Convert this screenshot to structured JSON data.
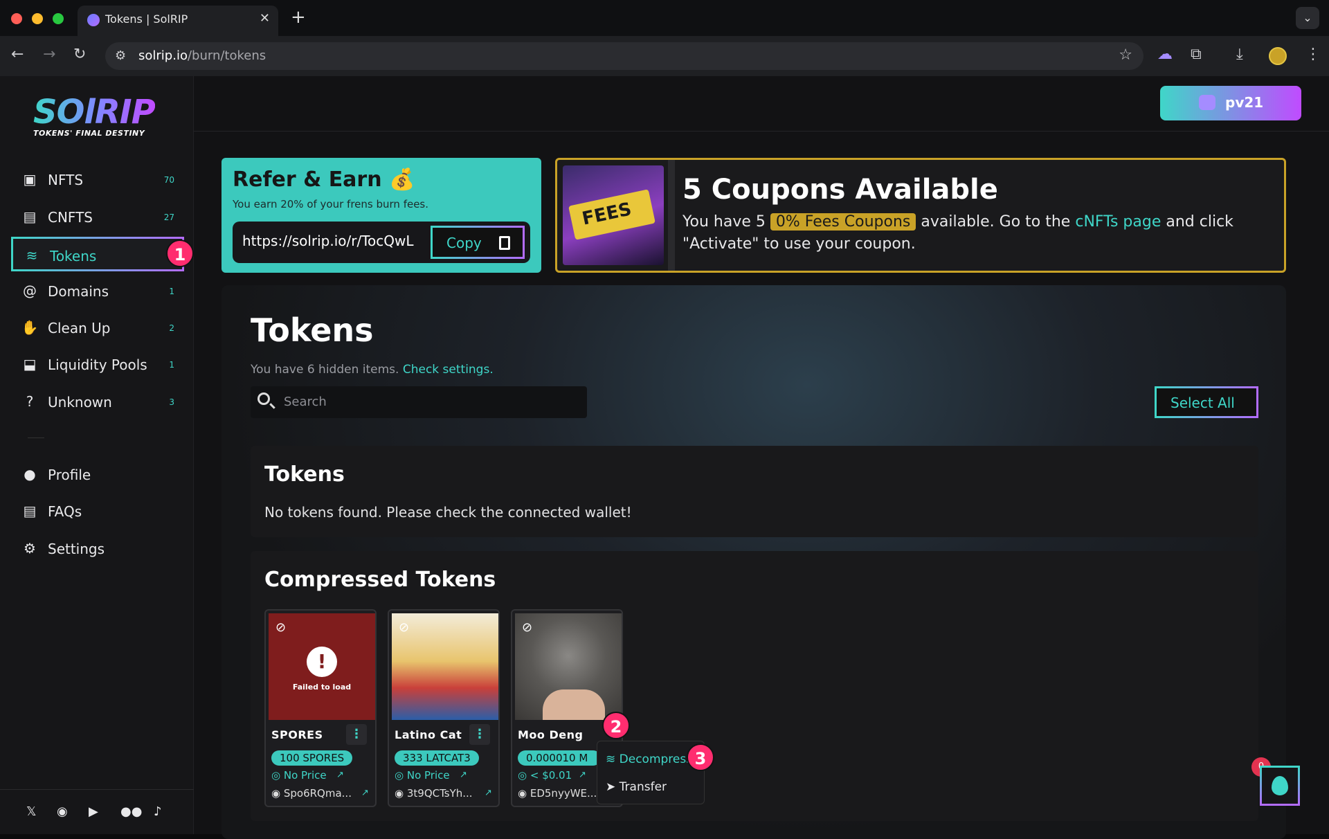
{
  "browser": {
    "tab_title": "Tokens | SolRIP",
    "url_host": "solrip.io",
    "url_path": "/burn/tokens"
  },
  "brand": {
    "logo_text": "SOlRIP",
    "tagline": "TOKENS' FINAL DESTINY",
    "accent": "#3fd6c8",
    "accent2": "#b36cff",
    "gold": "#c9a227"
  },
  "sidebar": {
    "items": [
      {
        "label": "NFTS",
        "count": "70",
        "icon": "image-icon"
      },
      {
        "label": "CNFTS",
        "count": "27",
        "icon": "file-icon"
      },
      {
        "label": "Tokens",
        "count": "",
        "icon": "coins-icon"
      },
      {
        "label": "Domains",
        "count": "1",
        "icon": "at-icon"
      },
      {
        "label": "Clean Up",
        "count": "2",
        "icon": "broom-icon"
      },
      {
        "label": "Liquidity Pools",
        "count": "1",
        "icon": "box-icon"
      },
      {
        "label": "Unknown",
        "count": "3",
        "icon": "question-icon"
      }
    ],
    "secondary": [
      {
        "label": "Profile",
        "icon": "user-icon"
      },
      {
        "label": "FAQs",
        "icon": "document-icon"
      },
      {
        "label": "Settings",
        "icon": "gear-icon"
      }
    ],
    "social": [
      "x-icon",
      "discord-icon",
      "youtube-icon",
      "medium-icon",
      "tiktok-icon"
    ]
  },
  "annotations": {
    "one": "1",
    "two": "2",
    "three": "3"
  },
  "wallet": {
    "label": "pv21"
  },
  "refer": {
    "title": "Refer & Earn 💰",
    "subtitle": "You earn 20% of your frens burn fees.",
    "url": "https://solrip.io/r/TocQwL",
    "copy_label": "Copy"
  },
  "coupon": {
    "title": "5 Coupons Available",
    "text_1": "You have 5",
    "highlight": "0% Fees Coupons",
    "text_2": "available. Go to the",
    "link": "cNFTs page",
    "text_3": "and click",
    "text_4": "\"Activate\" to use your coupon.",
    "image_text": "FEES"
  },
  "main": {
    "title": "Tokens",
    "hidden_note": "You have 6 hidden items.",
    "hidden_link": "Check settings.",
    "search_placeholder": "Search",
    "select_all": "Select All",
    "tokens_box": {
      "title": "Tokens",
      "message": "No tokens found. Please check the connected wallet!"
    },
    "compressed": {
      "title": "Compressed Tokens",
      "cards": [
        {
          "name": "SPORES",
          "amount": "100 SPORES",
          "price": "No Price",
          "address": "Spo6RQma...",
          "image_error": "Failed to load"
        },
        {
          "name": "Latino Cat",
          "amount": "333 LATCAT3",
          "price": "No Price",
          "address": "3t9QCTsYh..."
        },
        {
          "name": "Moo Deng",
          "amount": "0.000010 M",
          "price": "< $0.01",
          "address": "ED5nyyWE..."
        }
      ]
    }
  },
  "context_menu": {
    "items": [
      "Decompress",
      "Transfer"
    ]
  },
  "fab": {
    "count": "0"
  }
}
